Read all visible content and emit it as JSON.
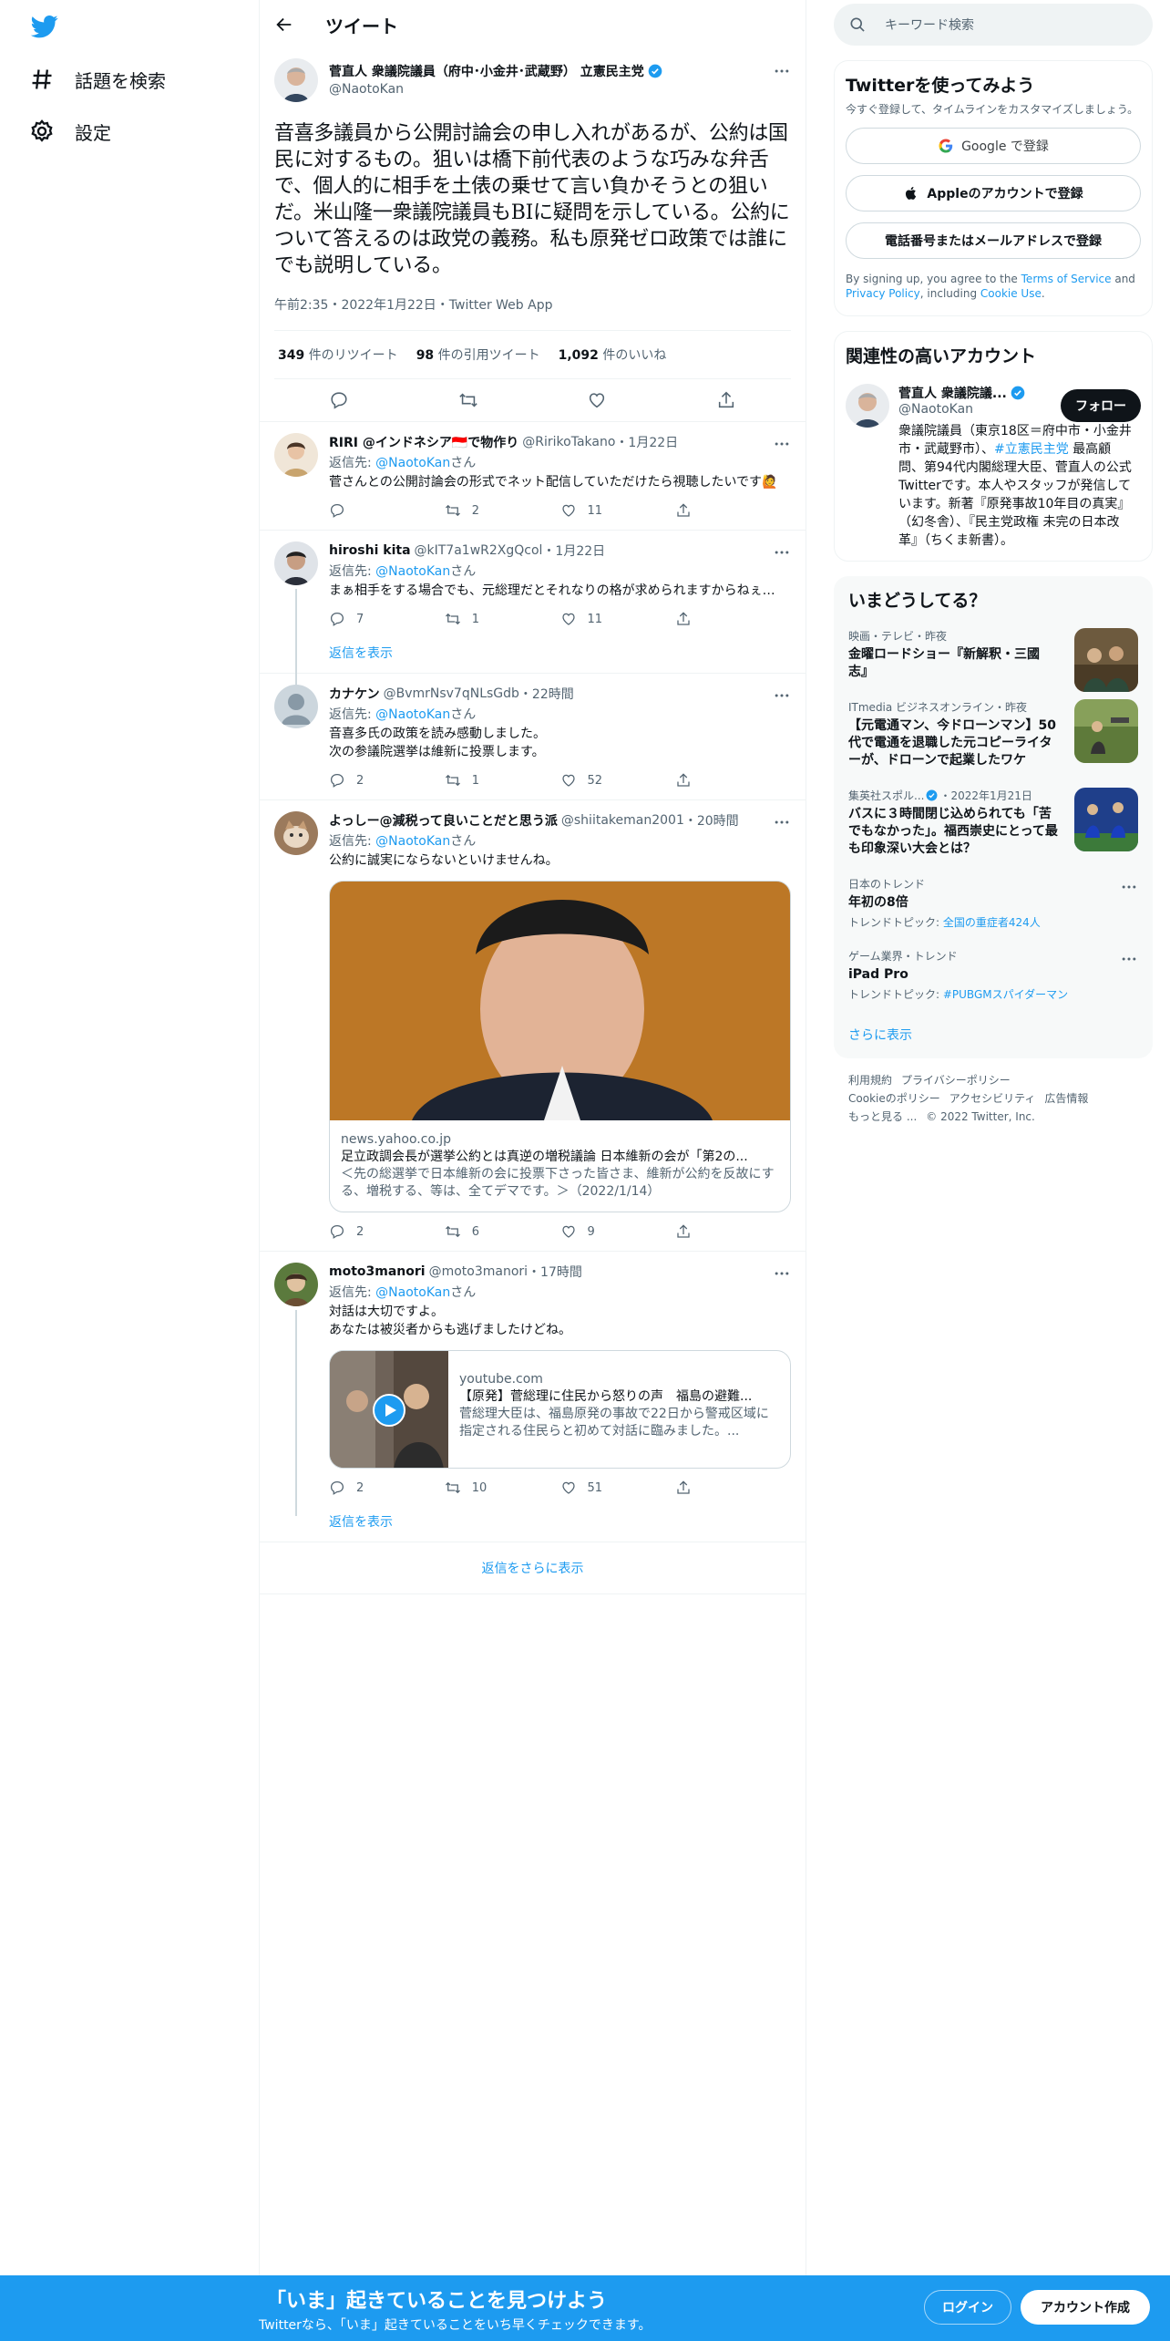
{
  "nav": {
    "explore_label": "話題を検索",
    "settings_label": "設定"
  },
  "header": {
    "title": "ツイート"
  },
  "tweet": {
    "author_name": "菅直人 衆議院議員（府中･小金井･武蔵野） 立憲民主党",
    "author_handle": "@NaotoKan",
    "text": "音喜多議員から公開討論会の申し入れがあるが、公約は国民に対するもの。狙いは橋下前代表のような巧みな弁舌で、個人的に相手を土俵の乗せて言い負かそうとの狙いだ。米山隆一衆議院議員もBIに疑問を示している。公約について答えるのは政党の義務。私も原発ゼロ政策では誰にでも説明している。",
    "meta": "午前2:35・2022年1月22日・Twitter Web App",
    "retweets_count": "349",
    "retweets_label": "件のリツイート",
    "quotes_count": "98",
    "quotes_label": "件の引用ツイート",
    "likes_count": "1,092",
    "likes_label": "件のいいね"
  },
  "replies": [
    {
      "name": "RIRI @インドネシア🇮🇩で物作り",
      "handle": "@RirikoTakano",
      "time": "・1月22日",
      "to_prefix": "返信先: ",
      "to_handle": "@NaotoKan",
      "to_suffix": "さん",
      "text": "菅さんとの公開討論会の形式でネット配信していただけたら視聴したいです🙋",
      "replies": "",
      "retweets": "2",
      "likes": "11"
    },
    {
      "name": "hiroshi kita",
      "handle": "@kIT7a1wR2XgQcol",
      "time": "・1月22日",
      "to_prefix": "返信先: ",
      "to_handle": "@NaotoKan",
      "to_suffix": "さん",
      "text": "まぁ相手をする場合でも、元総理だとそれなりの格が求められますからねぇ…",
      "replies": "7",
      "retweets": "1",
      "likes": "11",
      "show_replies": "返信を表示"
    },
    {
      "name": "カナケン",
      "handle": "@BvmrNsv7qNLsGdb",
      "time": "・22時間",
      "to_prefix": "返信先: ",
      "to_handle": "@NaotoKan",
      "to_suffix": "さん",
      "text": "音喜多氏の政策を読み感動しました。\n次の参議院選挙は維新に投票します。",
      "replies": "2",
      "retweets": "1",
      "likes": "52"
    },
    {
      "name": "よっしー@減税って良いことだと思う派",
      "handle": "@shiitakeman2001",
      "time": "・20時間",
      "to_prefix": "返信先: ",
      "to_handle": "@NaotoKan",
      "to_suffix": "さん",
      "text": "公約に誠実にならないといけませんね。",
      "card_domain": "news.yahoo.co.jp",
      "card_title": "足立政調会長が選挙公約とは真逆の増税議論 日本維新の会が「第2の...",
      "card_desc": "＜先の総選挙で日本維新の会に投票下さった皆さま、維新が公約を反故にする、増税する、等は、全てデマです。＞（2022/1/14）",
      "replies": "2",
      "retweets": "6",
      "likes": "9"
    },
    {
      "name": "moto3manori",
      "handle": "@moto3manori",
      "time": "・17時間",
      "to_prefix": "返信先: ",
      "to_handle": "@NaotoKan",
      "to_suffix": "さん",
      "text": "対話は大切ですよ。\nあなたは被災者からも逃げましたけどね。",
      "card_domain": "youtube.com",
      "card_title": "【原発】菅総理に住民から怒りの声　福島の避難...",
      "card_desc": "菅総理大臣は、福島原発の事故で22日から警戒区域に指定される住民らと初めて対話に臨みました。...",
      "replies": "2",
      "retweets": "10",
      "likes": "51",
      "show_replies": "返信を表示"
    }
  ],
  "more_replies_label": "返信をさらに表示",
  "right": {
    "search_placeholder": "キーワード検索",
    "signup": {
      "title": "Twitterを使ってみよう",
      "subtitle": "今すぐ登録して、タイムラインをカスタマイズしましょう。",
      "google_label": "Google で登録",
      "apple_label": "Appleのアカウントで登録",
      "phone_label": "電話番号またはメールアドレスで登録",
      "terms_prefix": "By signing up, you agree to the ",
      "terms_link": "Terms of Service",
      "terms_and": " and ",
      "privacy_link": "Privacy Policy",
      "terms_including": ", including ",
      "cookie_link": "Cookie Use",
      "terms_end": "."
    },
    "related": {
      "title": "関連性の高いアカウント",
      "name": "菅直人 衆議院議...",
      "handle": "@NaotoKan",
      "follow_label": "フォロー",
      "bio_1": "衆議院議員（東京18区＝府中市・小金井市・武蔵野市）、",
      "bio_hashtag": "#立憲民主党",
      "bio_2": " 最高顧問、第94代内閣総理大臣、菅直人の公式Twitterです。本人やスタッフが発信しています。新著『原発事故10年目の真実』（幻冬舎）、『民主党政権 未完の日本改革』（ちくま新書）。"
    },
    "trends": {
      "title": "いまどうしてる？",
      "items": [
        {
          "meta": "映画・テレビ・昨夜",
          "title": "金曜ロードショー『新解釈・三國志』"
        },
        {
          "meta": "ITmedia ビジネスオンライン・昨夜",
          "title": "【元電通マン、今ドローンマン】50代で電通を退職した元コピーライターが、ドローンで起業したワケ"
        },
        {
          "meta": "集英社スポル...",
          "meta2": "・2022年1月21日",
          "title": "バスに３時間閉じ込められても「苦でもなかった」。福西崇史にとって最も印象深い大会とは？"
        },
        {
          "meta": "日本のトレンド",
          "title": "年初の8倍",
          "sub_prefix": "トレンドトピック: ",
          "sub_link": "全国の重症者424人"
        },
        {
          "meta": "ゲーム業界・トレンド",
          "title": "iPad Pro",
          "sub_prefix": "トレンドトピック: ",
          "sub_link": "#PUBGMスパイダーマン"
        }
      ],
      "show_more": "さらに表示"
    },
    "footer": {
      "terms": "利用規約",
      "privacy": "プライバシーポリシー",
      "cookie": "Cookieのポリシー",
      "accessibility": "アクセシビリティ",
      "ads": "広告情報",
      "more": "もっと見る ...",
      "copyright": "© 2022 Twitter, Inc."
    }
  },
  "bottom": {
    "title": "「いま」起きていることを見つけよう",
    "subtitle": "Twitterなら、「いま」起きていることをいち早くチェックできます。",
    "login": "ログイン",
    "signup": "アカウント作成"
  },
  "colors": {
    "accent": "#1d9bf0",
    "text": "#0f1419",
    "secondary": "#536471"
  }
}
